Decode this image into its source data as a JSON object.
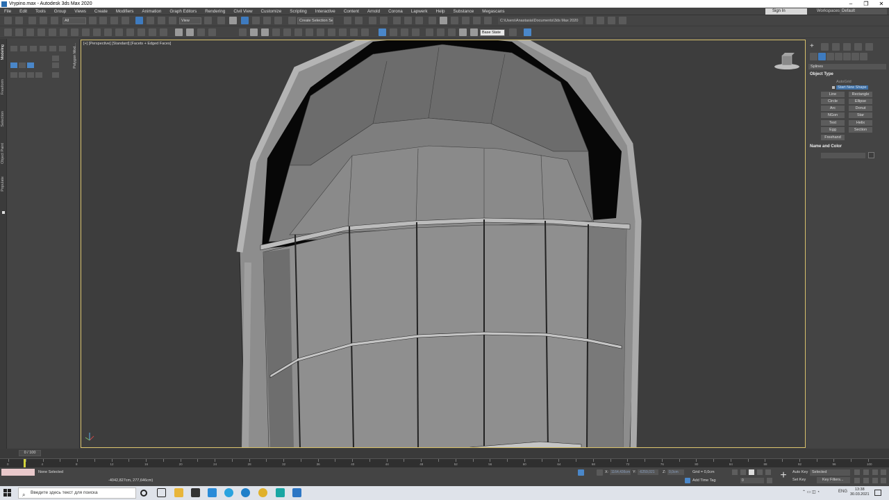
{
  "window": {
    "title": "Vrypino.max - Autodesk 3ds Max 2020"
  },
  "menu": [
    "File",
    "Edit",
    "Tools",
    "Group",
    "Views",
    "Create",
    "Modifiers",
    "Animation",
    "Graph Editors",
    "Rendering",
    "Civil View",
    "Customize",
    "Scripting",
    "Interactive",
    "Content",
    "Arnold",
    "Corona",
    "Lapwerk",
    "Help",
    "Substance",
    "Megascans"
  ],
  "account": {
    "sign_in": "Sign In",
    "workspaces_label": "Workspaces:",
    "workspace": "Default"
  },
  "toolbar": {
    "filter": "All",
    "ref_coord": "View",
    "selection_set": "Create Selection Se",
    "project_path": "C:\\Users\\Anastasia\\Documents\\3ds Max 2020",
    "base_state": "Base State"
  },
  "left_tabs": [
    "Modeling",
    "Freeform",
    "Selection",
    "Object Paint",
    "Populate"
  ],
  "ribbon_label": "Polygon Mod...",
  "viewport": {
    "label": "[+] [Perspective] [Standard] [Facets + Edged Faces]"
  },
  "command_panel": {
    "category": "Splines",
    "rollout_object_type": "Object Type",
    "autogrid": "AutoGrid",
    "start_new_shape": "Start New Shape",
    "buttons": [
      "Line",
      "Rectangle",
      "Circle",
      "Ellipse",
      "Arc",
      "Donut",
      "NGon",
      "Star",
      "Text",
      "Helix",
      "Egg",
      "Section",
      "Freehand"
    ],
    "rollout_name_color": "Name and Color"
  },
  "time": {
    "slider": "0 / 100",
    "ticks": [
      0,
      2,
      4,
      6,
      8,
      10,
      12,
      14,
      16,
      18,
      20,
      22,
      24,
      26,
      28,
      30,
      32,
      34,
      36,
      38,
      40,
      42,
      44,
      46,
      48,
      50,
      52,
      54,
      56,
      58,
      60,
      62,
      64,
      66,
      68,
      70,
      72,
      74,
      76,
      78,
      80,
      82,
      84,
      86,
      88,
      90,
      92,
      94,
      96,
      98,
      100
    ]
  },
  "status": {
    "selection": "None Selected",
    "coords_readout": "-4042,827cm, 277,646cm)",
    "x_label": "X:",
    "x_value": "1164,436cm",
    "y_label": "Y:",
    "y_value": "-6259,021",
    "z_label": "Z:",
    "z_value": "0,0cm",
    "grid": "Grid = 0,0cm",
    "add_time_tag": "Add Time Tag",
    "auto_key": "Auto Key",
    "selected": "Selected",
    "set_key": "Set Key",
    "key_filters": "Key Filters...",
    "frame_value": "0"
  },
  "taskbar": {
    "search_placeholder": "Введите здесь текст для поиска",
    "language": "ENG",
    "time": "13:38",
    "date": "30.03.2021"
  }
}
